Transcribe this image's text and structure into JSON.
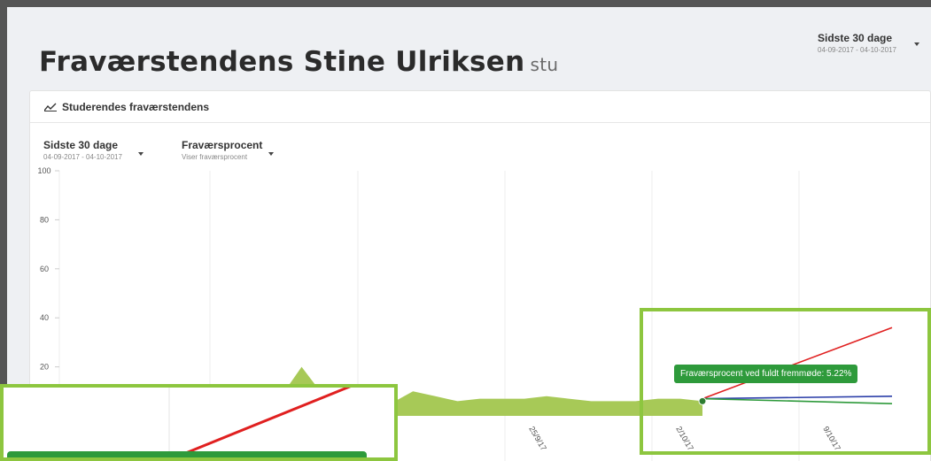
{
  "header": {
    "title": "Fraværstendens Stine Ulriksen",
    "subtitle": "stu",
    "period_label": "Sidste 30 dage",
    "period_range": "04-09-2017 - 04-10-2017"
  },
  "card": {
    "title": "Studerendes fraværstendens",
    "filters": {
      "period_label": "Sidste 30 dage",
      "period_range": "04-09-2017 - 04-10-2017",
      "metric_label": "Fraværsprocent",
      "metric_sub": "Viser fraværsprocent"
    }
  },
  "tooltip": {
    "text": "Fraværsprocent ved fuldt fremmøde: 5.22%"
  },
  "chart_data": {
    "type": "area",
    "ylim": [
      0,
      100
    ],
    "yticks": [
      100,
      80,
      60,
      40,
      20
    ],
    "xtick_labels": [
      "25/9/17",
      "2/10/17",
      "9/10/17"
    ],
    "series": [
      {
        "values": [
          3,
          3,
          4,
          7,
          20,
          8,
          7,
          9,
          5,
          10,
          8,
          6,
          7,
          7,
          7,
          8,
          7,
          6,
          6,
          6,
          7,
          7,
          6
        ]
      }
    ],
    "projections": [
      {
        "color": "#e02020",
        "from": 7,
        "to": 36
      },
      {
        "color": "#2a3da8",
        "from": 7,
        "to": 8
      },
      {
        "color": "#2e9a3b",
        "from": 7,
        "to": 5
      }
    ],
    "colors": {
      "area": "#a7c957",
      "point": "#2e7d32"
    }
  }
}
